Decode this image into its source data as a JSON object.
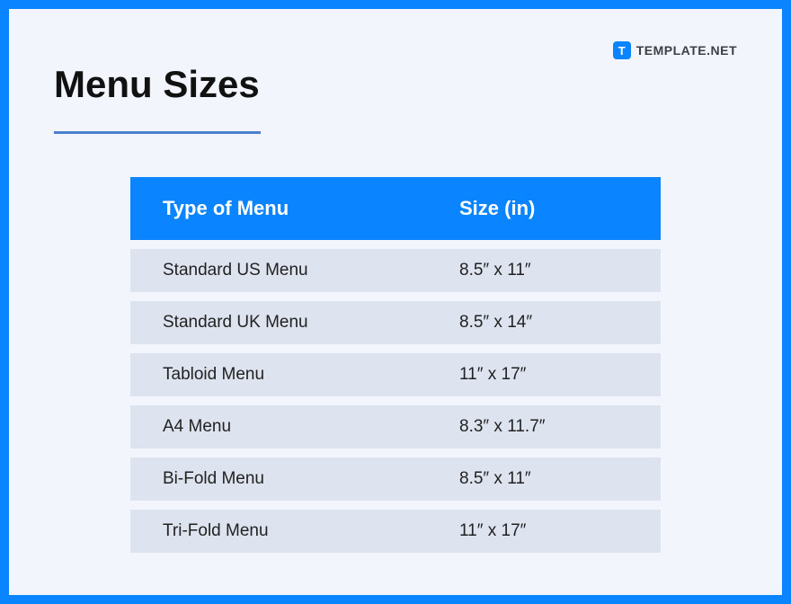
{
  "brand": {
    "icon_letter": "T",
    "name": "TEMPLATE.NET"
  },
  "title": "Menu Sizes",
  "table": {
    "headers": {
      "type": "Type of Menu",
      "size": "Size (in)"
    },
    "rows": [
      {
        "type": "Standard US Menu",
        "size": "8.5″ x 11″"
      },
      {
        "type": "Standard UK Menu",
        "size": "8.5″ x 14″"
      },
      {
        "type": "Tabloid Menu",
        "size": "11″ x 17″"
      },
      {
        "type": "A4 Menu",
        "size": "8.3″ x 11.7″"
      },
      {
        "type": "Bi-Fold Menu",
        "size": "8.5″ x 11″"
      },
      {
        "type": "Tri-Fold Menu",
        "size": "11″ x 17″"
      }
    ]
  }
}
